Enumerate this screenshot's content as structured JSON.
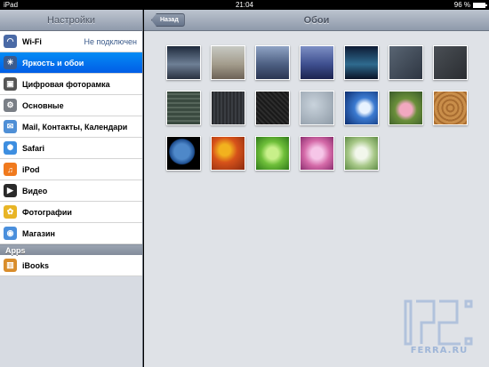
{
  "status_bar": {
    "device": "iPad",
    "time": "21:04",
    "battery": "96 %",
    "battery_level": 0.96
  },
  "sidebar": {
    "title": "Настройки",
    "items": [
      {
        "label": "Wi-Fi",
        "icon": "wifi-icon",
        "detail": "Не подключен",
        "color": "#4a6aa6"
      },
      {
        "label": "Яркость и обои",
        "icon": "brightness-icon",
        "selected": true,
        "color": "#3b5b8e"
      },
      {
        "label": "Цифровая фоторамка",
        "icon": "photo-frame-icon",
        "color": "#555555"
      },
      {
        "label": "Основные",
        "icon": "gear-icon",
        "color": "#7a7f86"
      },
      {
        "label": "Mail, Контакты, Календари",
        "icon": "mail-icon",
        "color": "#4f8fd6"
      },
      {
        "label": "Safari",
        "icon": "safari-compass-icon",
        "color": "#3d8ee0"
      },
      {
        "label": "iPod",
        "icon": "ipod-icon",
        "color": "#f07a1e"
      },
      {
        "label": "Видео",
        "icon": "video-icon",
        "color": "#2a2a2a"
      },
      {
        "label": "Фотографии",
        "icon": "sunflower-icon",
        "color": "#e8b526"
      },
      {
        "label": "Магазин",
        "icon": "store-icon",
        "color": "#4a8fdc"
      }
    ],
    "section_apps": "Apps",
    "apps": [
      {
        "label": "iBooks",
        "icon": "ibooks-icon",
        "color": "#d98d2b"
      }
    ]
  },
  "main": {
    "title": "Обои",
    "back_label": "Назад",
    "wallpapers": [
      {
        "name": "mountain-dusk",
        "bg": "linear-gradient(#1e2a3c, #6e7f95 55%, #2a3240)"
      },
      {
        "name": "beach-sky",
        "bg": "linear-gradient(#c7c9c3, #a39c8c 55%, #6d6256)"
      },
      {
        "name": "lake-mountains",
        "bg": "linear-gradient(#8fa3c4, #4d5f82 55%, #2a3552)"
      },
      {
        "name": "blue-hills",
        "bg": "linear-gradient(#7d8fc4, #3e4f8f 55%, #1c2350)"
      },
      {
        "name": "aurora",
        "bg": "linear-gradient(#0d1a33, #2e6a8e 55%, #0a1427)"
      },
      {
        "name": "gray-texture",
        "bg": "linear-gradient(135deg, #596573, #2e3642)"
      },
      {
        "name": "dark-gray",
        "bg": "linear-gradient(135deg, #4a4f55, #2a2d31)"
      },
      {
        "name": "plaid-green",
        "bg": "repeating-linear-gradient(0deg, #3a4a40 0 3px, #55655a 3px 5px), #3a4a40"
      },
      {
        "name": "dark-stripes",
        "bg": "repeating-linear-gradient(90deg, #2a2c30 0 2px, #3a3d42 2px 4px)"
      },
      {
        "name": "black-weave",
        "bg": "repeating-linear-gradient(45deg, #1a1a1a 0 2px, #2c2c2c 2px 4px)"
      },
      {
        "name": "water-drops",
        "bg": "radial-gradient(circle at 40% 40%, #c9d3dc, #8e9aa6)"
      },
      {
        "name": "wave",
        "bg": "radial-gradient(circle at 60% 50%, #e8f3ff 0 20%, #3b7ad0 40%, #0d2e70)"
      },
      {
        "name": "lotus",
        "bg": "radial-gradient(circle at 50% 55%, #f2a8c0 0 25%, #6a8f3a 45%, #3a5a2a)"
      },
      {
        "name": "wood-rings",
        "bg": "repeating-radial-gradient(circle at 50% 50%, #c98e4a 0 3px, #a86c30 3px 5px)"
      },
      {
        "name": "earth",
        "bg": "radial-gradient(circle at 45% 45%, #4e88c9 0 30%, #1d4d8f 48%, #000 52%)"
      },
      {
        "name": "autumn-leaves",
        "bg": "radial-gradient(circle at 40% 40%, #f2b21e 0 20%, #d6521a 45%, #8c2b10)"
      },
      {
        "name": "green-leaves",
        "bg": "radial-gradient(circle at 50% 50%, #c8f08a 0 25%, #6fbf3a 50%, #2f7a1a)"
      },
      {
        "name": "pink-flowers",
        "bg": "radial-gradient(circle at 50% 50%, #f6c6e8 0 25%, #d46aa8 55%, #8c2f70)"
      },
      {
        "name": "white-flowers",
        "bg": "radial-gradient(circle at 50% 50%, #f2f7ec 0 25%, #a9c98a 55%, #5f8c45)"
      }
    ],
    "watermark_text": "FERRA.RU"
  }
}
